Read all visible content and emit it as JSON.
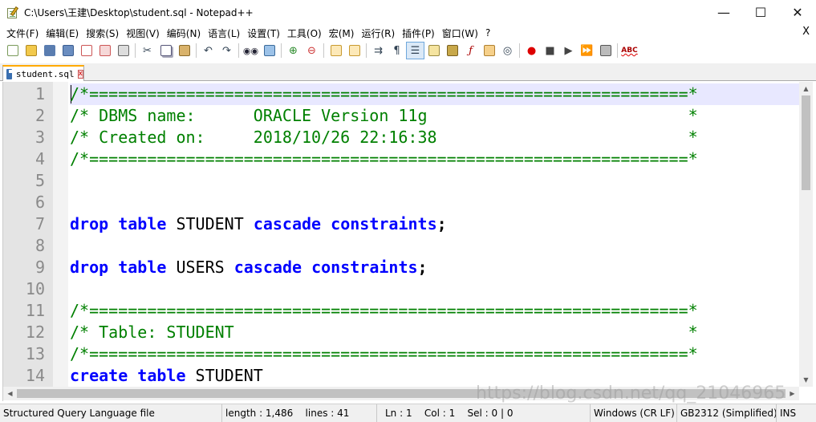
{
  "window": {
    "title": "C:\\Users\\王建\\Desktop\\student.sql - Notepad++",
    "minimize": "—",
    "maximize": "☐",
    "close": "✕"
  },
  "menu": {
    "items": [
      "文件(F)",
      "编辑(E)",
      "搜索(S)",
      "视图(V)",
      "编码(N)",
      "语言(L)",
      "设置(T)",
      "工具(O)",
      "宏(M)",
      "运行(R)",
      "插件(P)",
      "窗口(W)",
      "?"
    ],
    "close": "X"
  },
  "toolbar": {
    "spell_check": "ABC",
    "buttons": [
      "new-file",
      "open-file",
      "save",
      "save-all",
      "close",
      "close-all",
      "print",
      "cut",
      "copy",
      "paste",
      "undo",
      "redo",
      "find",
      "replace",
      "zoom-in",
      "zoom-out",
      "sync-vertical",
      "sync-horizontal",
      "word-wrap",
      "show-all-chars",
      "indent-guide",
      "user-defined-language",
      "document-map",
      "function-list",
      "folder-as-workspace",
      "monitoring",
      "record-macro",
      "stop-record",
      "play-macro",
      "run-macro-multiple",
      "save-macro",
      "spell-check"
    ]
  },
  "tab": {
    "label": "student.sql",
    "close": "x"
  },
  "editor": {
    "line_numbers": [
      "1",
      "2",
      "3",
      "4",
      "5",
      "6",
      "7",
      "8",
      "9",
      "10",
      "11",
      "12",
      "13",
      "14"
    ],
    "lines": [
      [
        {
          "t": "/*==============================================================*",
          "c": "comment"
        }
      ],
      [
        {
          "t": "/* DBMS name:      ORACLE Version 11g                           *",
          "c": "comment"
        }
      ],
      [
        {
          "t": "/* Created on:     2018/10/26 22:16:38                          *",
          "c": "comment"
        }
      ],
      [
        {
          "t": "/*==============================================================*",
          "c": "comment"
        }
      ],
      [],
      [],
      [
        {
          "t": "drop",
          "c": "kw"
        },
        {
          "t": " ",
          "c": "id"
        },
        {
          "t": "table",
          "c": "kw"
        },
        {
          "t": " STUDENT ",
          "c": "id"
        },
        {
          "t": "cascade",
          "c": "kw"
        },
        {
          "t": " ",
          "c": "id"
        },
        {
          "t": "constraints",
          "c": "kw"
        },
        {
          "t": ";",
          "c": "op"
        }
      ],
      [],
      [
        {
          "t": "drop",
          "c": "kw"
        },
        {
          "t": " ",
          "c": "id"
        },
        {
          "t": "table",
          "c": "kw"
        },
        {
          "t": " USERS ",
          "c": "id"
        },
        {
          "t": "cascade",
          "c": "kw"
        },
        {
          "t": " ",
          "c": "id"
        },
        {
          "t": "constraints",
          "c": "kw"
        },
        {
          "t": ";",
          "c": "op"
        }
      ],
      [],
      [
        {
          "t": "/*==============================================================*",
          "c": "comment"
        }
      ],
      [
        {
          "t": "/* Table: STUDENT                                               *",
          "c": "comment"
        }
      ],
      [
        {
          "t": "/*==============================================================*",
          "c": "comment"
        }
      ],
      [
        {
          "t": "create",
          "c": "kw"
        },
        {
          "t": " ",
          "c": "id"
        },
        {
          "t": "table",
          "c": "kw"
        },
        {
          "t": " STUDENT",
          "c": "id"
        }
      ]
    ],
    "colors": {
      "comment": "#008000",
      "keyword": "#0000ff",
      "current_line": "#e8e8ff"
    }
  },
  "status": {
    "file_type": "Structured Query Language file",
    "length": "length : 1,486",
    "lines": "lines : 41",
    "ln": "Ln : 1",
    "col": "Col : 1",
    "sel": "Sel : 0 | 0",
    "eol": "Windows (CR LF)",
    "encoding": "GB2312 (Simplified)",
    "mode": "INS"
  },
  "watermark": "https://blog.csdn.net/qq_21046965"
}
